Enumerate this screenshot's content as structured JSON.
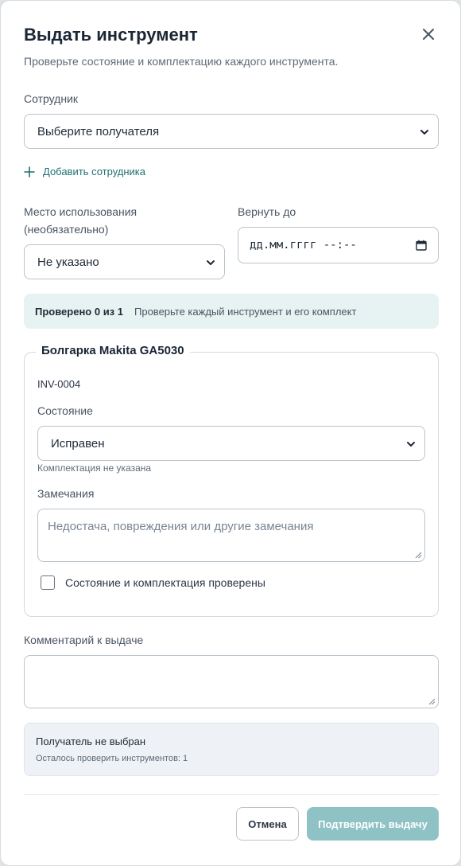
{
  "dialog": {
    "title": "Выдать инструмент",
    "subtitle": "Проверьте состояние и комплектацию каждого инструмента."
  },
  "employee": {
    "label": "Сотрудник",
    "selected": "Выберите получателя",
    "add_link": "Добавить сотрудника"
  },
  "location": {
    "label_line1": "Место использования",
    "label_line2": "(необязательно)",
    "selected": "Не указано"
  },
  "return_by": {
    "label": "Вернуть до",
    "placeholder": "дд.мм.гггг --:--"
  },
  "check_banner": {
    "status": "Проверено 0 из 1",
    "hint": "Проверьте каждый инструмент и его комплект"
  },
  "tool": {
    "name": "Болгарка Makita GA5030",
    "inventory_number": "INV-0004",
    "condition_label": "Состояние",
    "condition_selected": "Исправен",
    "kit_hint": "Комплектация не указана",
    "remarks_label": "Замечания",
    "remarks_placeholder": "Недостача, повреждения или другие замечания",
    "remarks_value": "",
    "checked_label": "Состояние и комплектация проверены",
    "checked": false
  },
  "comment": {
    "label": "Комментарий к выдаче",
    "value": ""
  },
  "summary": {
    "title": "Получатель не выбран",
    "subtitle": "Осталось проверить инструментов: 1"
  },
  "actions": {
    "cancel": "Отмена",
    "confirm": "Подтвердить выдачу"
  },
  "colors": {
    "accent": "#1f6f73",
    "confirm_button": "#8fc2c4",
    "banner_bg": "#e6f3f2",
    "summary_bg": "#eef1f5"
  }
}
